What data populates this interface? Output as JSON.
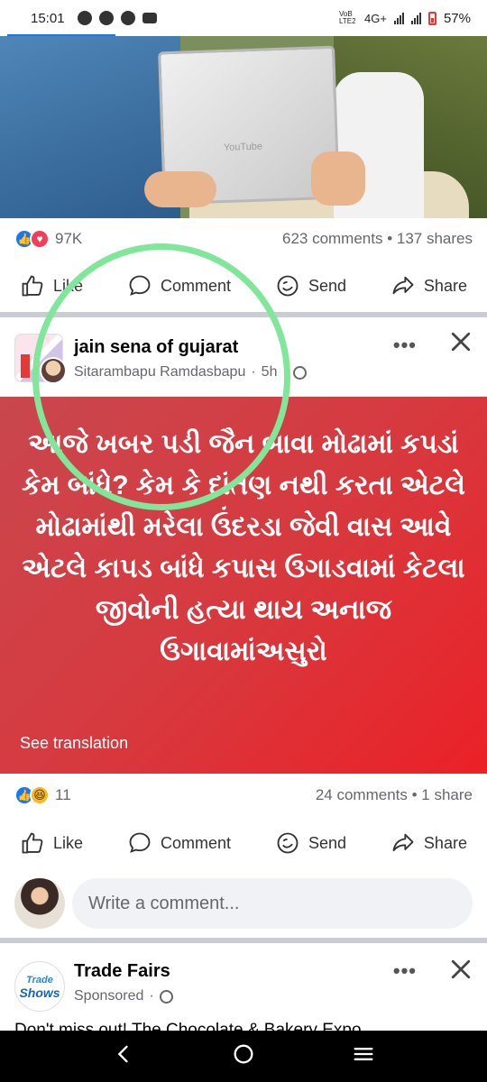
{
  "status_bar": {
    "time": "15:01",
    "network": "4G+",
    "volte": "VoB LTE2",
    "battery": "57%"
  },
  "post1": {
    "reaction_count": "97K",
    "comments_shares": "623 comments • 137 shares",
    "photo_plaque_text": "YouTube"
  },
  "actions": {
    "like": "Like",
    "comment": "Comment",
    "send": "Send",
    "share": "Share"
  },
  "post2": {
    "page_name": "jain sena of gujarat",
    "author": "Sitarambapu Ramdasbapu",
    "time": "5h",
    "body_text": "આજે ખબર પડી જૈન બાવા મોઢામાં કપડાં કેમ બાંધે? કેમ કે દાંતણ નથી કરતા એટલે મોઢામાંથી મરેલા ઉંદરડા જેવી વાસ આવે એટલે કાપડ બાંધે કપાસ ઉગાડવામાં કેટલા જીવોની હત્યા થાય અનાજ ઉગાવામાંઅસુરો",
    "see_translation": "See translation",
    "reaction_count": "11",
    "comments_shares": "24 comments • 1 share",
    "background_colors": [
      "#c9474e",
      "#eb2127"
    ]
  },
  "comment_box": {
    "placeholder": "Write a comment..."
  },
  "ad": {
    "advertiser": "Trade Fairs",
    "avatar_line1": "Trade",
    "avatar_line2": "Shows",
    "label": "Sponsored",
    "text": "Don't miss out! The Chocolate & Bakery Expo"
  },
  "icons": [
    "like-reaction-icon",
    "love-reaction-icon",
    "haha-reaction-icon",
    "thumbs-up-icon",
    "speech-bubble-icon",
    "messenger-icon",
    "share-arrow-icon",
    "more-dots-icon",
    "close-icon",
    "globe-icon",
    "back-icon",
    "home-icon",
    "recents-icon"
  ],
  "colors": {
    "accent": "#1877f2",
    "annotation_circle": "#7fe69a"
  }
}
